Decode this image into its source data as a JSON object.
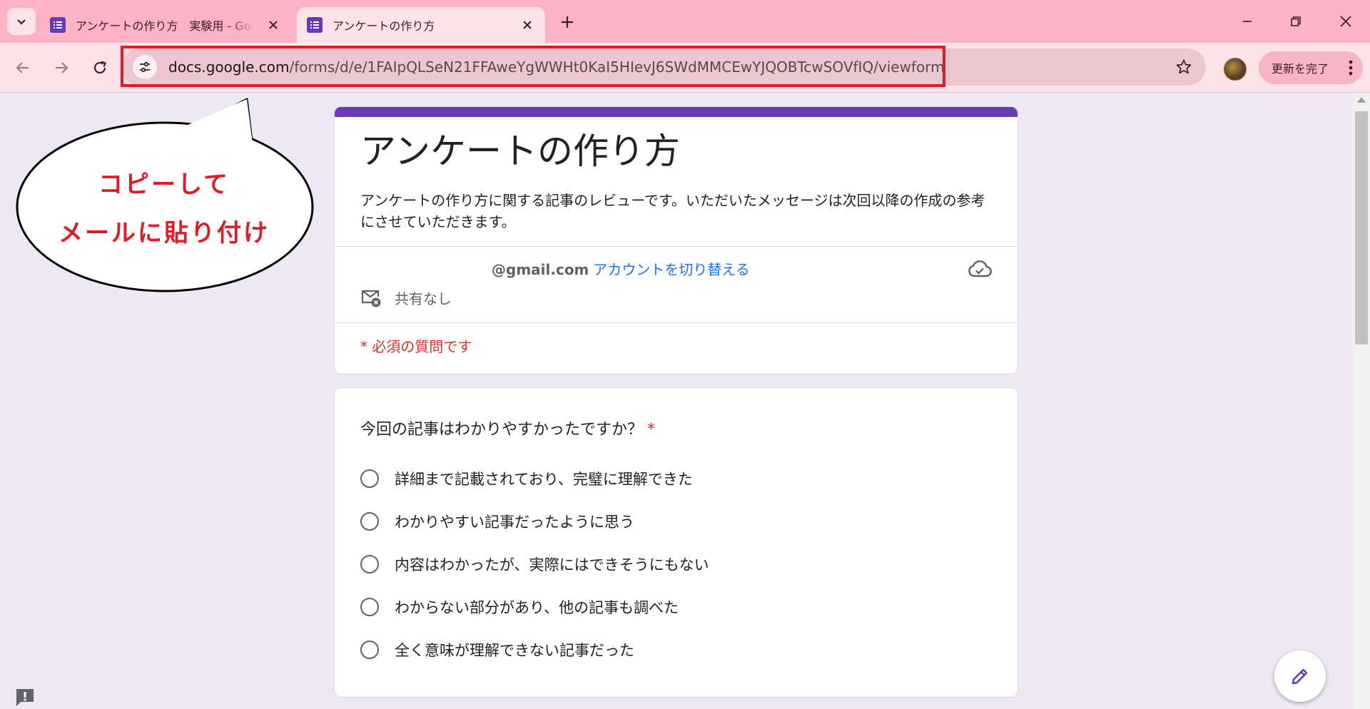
{
  "browser": {
    "tabs": [
      {
        "title": "アンケートの作り方　実験用 - Google フォーム",
        "active": false
      },
      {
        "title": "アンケートの作り方",
        "active": true
      }
    ],
    "url_host": "docs.google.com",
    "url_path": "/forms/d/e/1FAIpQLSeN21FFAweYgWWHt0KaI5HIevJ6SWdMMCEwYJQOBTcwSOVfIQ/viewform",
    "update_button": "更新を完了",
    "accent_color": "#fcb3c3"
  },
  "form": {
    "title": "アンケートの作り方",
    "description": "アンケートの作り方に関する記事のレビューです。いただいたメッセージは次回以降の作成の参考にさせていただきます。",
    "account_email": "@gmail.com",
    "switch_account": "アカウントを切り替える",
    "not_shared": "共有なし",
    "required_note": "* 必須の質問です",
    "accent_color": "#673ab7"
  },
  "question": {
    "title": "今回の記事はわかりやすかったですか？",
    "required_mark": "*",
    "options": [
      "詳細まで記載されており、完璧に理解できた",
      "わかりやすい記事だったように思う",
      "内容はわかったが、実際にはできそうにもない",
      "わからない部分があり、他の記事も調べた",
      "全く意味が理解できない記事だった"
    ]
  },
  "annotation": {
    "line1": "コピーして",
    "line2": "メールに貼り付け",
    "color": "#e01b24"
  },
  "icons": [
    "chevron-down-icon",
    "forms-favicon",
    "close-icon",
    "plus-icon",
    "minimize-icon",
    "restore-icon",
    "window-close-icon",
    "back-arrow-icon",
    "forward-arrow-icon",
    "reload-icon",
    "site-info-icon",
    "bookmark-star-icon",
    "profile-avatar",
    "more-vert-icon",
    "cloud-done-icon",
    "mail-off-icon",
    "edit-pencil-icon",
    "feedback-icon"
  ]
}
